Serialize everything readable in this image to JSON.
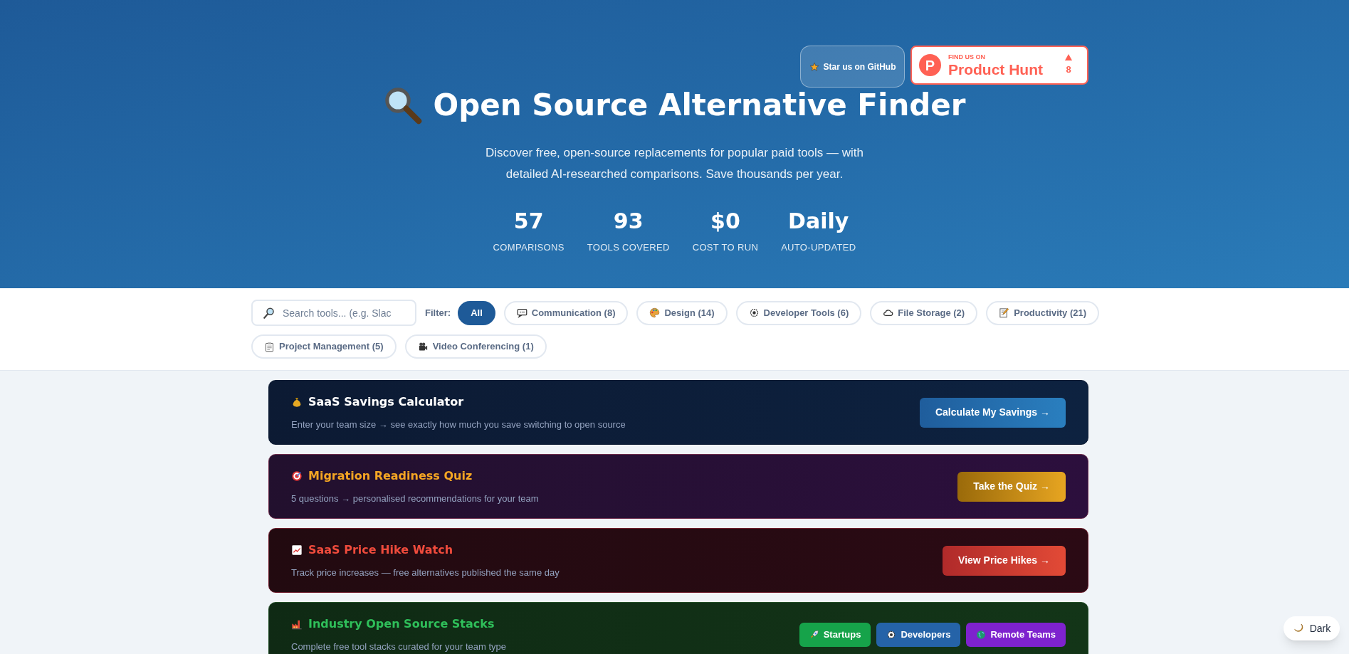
{
  "hero": {
    "title": "Open Source Alternative Finder",
    "subtitle": "Discover free, open-source replacements for popular paid tools — with detailed AI-researched comparisons. Save thousands per year.",
    "github_button": "Star us on GitHub",
    "product_hunt": {
      "logo_letter": "P",
      "eyebrow": "FIND US ON",
      "name": "Product Hunt",
      "votes": "8"
    },
    "stats": [
      {
        "value": "57",
        "label": "COMPARISONS"
      },
      {
        "value": "93",
        "label": "TOOLS COVERED"
      },
      {
        "value": "$0",
        "label": "COST TO RUN"
      },
      {
        "value": "Daily",
        "label": "AUTO-UPDATED"
      }
    ]
  },
  "filter_bar": {
    "search": {
      "placeholder": "Search tools... (e.g. Slac"
    },
    "label": "Filter:",
    "chips": [
      {
        "kind": "all",
        "label": "All",
        "selected": true
      },
      {
        "kind": "chat",
        "label": "Communication (8)",
        "selected": false
      },
      {
        "kind": "palette",
        "label": "Design (14)",
        "selected": false
      },
      {
        "kind": "gear",
        "label": "Developer Tools (6)",
        "selected": false
      },
      {
        "kind": "cloud",
        "label": "File Storage (2)",
        "selected": false
      },
      {
        "kind": "memo",
        "label": "Productivity (21)",
        "selected": false
      },
      {
        "kind": "clipboard",
        "label": "Project Management (5)",
        "selected": false
      },
      {
        "kind": "camera",
        "label": "Video Conferencing (1)",
        "selected": false
      }
    ]
  },
  "promo_cards": [
    {
      "kind": "savings",
      "title": "SaaS Savings Calculator",
      "description": "Enter your team size → see exactly how much you save switching to open source",
      "buttons": [
        {
          "kind": "plain",
          "label": "Calculate My Savings →"
        }
      ]
    },
    {
      "kind": "quiz",
      "title": "Migration Readiness Quiz",
      "description": "5 questions → personalised recommendations for your team",
      "buttons": [
        {
          "kind": "plain",
          "label": "Take the Quiz →"
        }
      ]
    },
    {
      "kind": "prices",
      "title": "SaaS Price Hike Watch",
      "description": "Track price increases — free alternatives published the same day",
      "buttons": [
        {
          "kind": "plain",
          "label": "View Price Hikes →"
        }
      ]
    },
    {
      "kind": "stacks",
      "title": "Industry Open Source Stacks",
      "description": "Complete free tool stacks curated for your team type",
      "buttons": [
        {
          "kind": "rocket",
          "label": "Startups",
          "color": "#16a34a"
        },
        {
          "kind": "gear",
          "label": "Developers",
          "color": "#2563a8"
        },
        {
          "kind": "globe",
          "label": "Remote Teams",
          "color": "#7e22ce"
        }
      ]
    }
  ],
  "theme_toggle": {
    "label": "Dark"
  }
}
